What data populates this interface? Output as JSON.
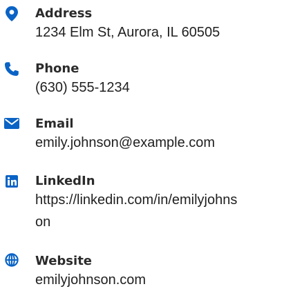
{
  "contact": {
    "items": [
      {
        "icon": "map-pin-icon",
        "label": "Address",
        "value": "1234 Elm St, Aurora, IL 60505"
      },
      {
        "icon": "phone-icon",
        "label": "Phone",
        "value": "(630) 555-1234"
      },
      {
        "icon": "envelope-icon",
        "label": "Email",
        "value": "emily.johnson@example.com"
      },
      {
        "icon": "linkedin-icon",
        "label": "LinkedIn",
        "value": "https://linkedin.com/in/emilyjohnson"
      },
      {
        "icon": "globe-icon",
        "label": "Website",
        "value": "emilyjohnson.com"
      }
    ]
  },
  "colors": {
    "icon_accent": "#0a63c5",
    "label_text": "#2b2b2b",
    "value_text": "#1f1f1f"
  }
}
